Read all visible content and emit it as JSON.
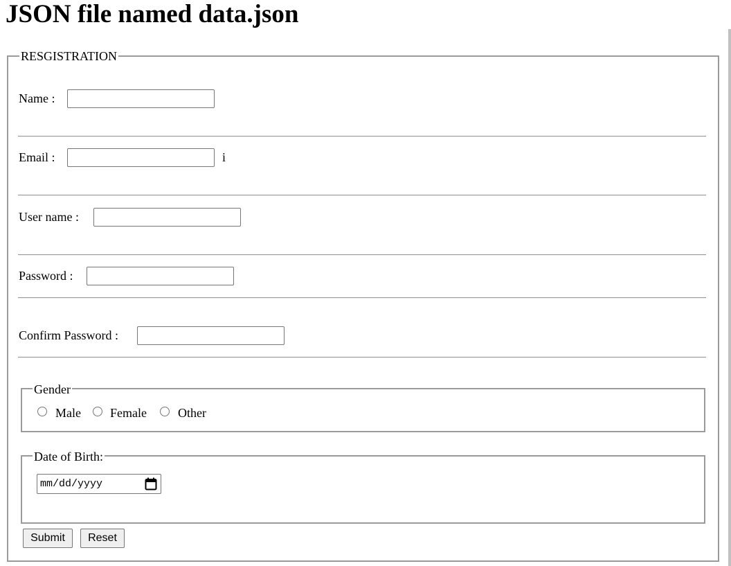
{
  "page": {
    "title": "JSON file named data.json"
  },
  "form": {
    "legend": "RESGISTRATION",
    "name_label": "Name :",
    "name_value": "",
    "email_label": "Email :",
    "email_value": "",
    "email_suffix": "i",
    "username_label": "User name :",
    "username_value": "",
    "password_label": "Password :",
    "password_value": "",
    "confirm_label": "Confirm Password :",
    "confirm_value": "",
    "gender": {
      "legend": "Gender",
      "options": [
        {
          "label": "Male",
          "checked": false
        },
        {
          "label": "Female",
          "checked": false
        },
        {
          "label": "Other",
          "checked": false
        }
      ]
    },
    "dob": {
      "legend": "Date of Birth:",
      "placeholder": "mm/dd/yyyy",
      "icon": "calendar-icon"
    },
    "buttons": {
      "submit": "Submit",
      "reset": "Reset"
    }
  }
}
